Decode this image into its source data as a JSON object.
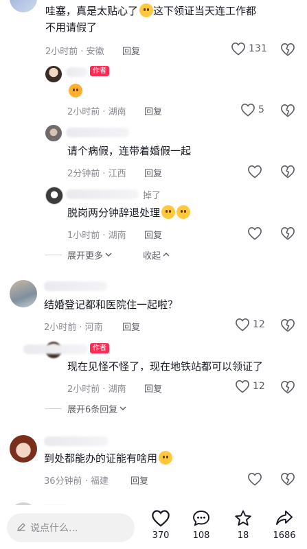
{
  "comments": [
    {
      "text": "哇塞，真是太贴心了",
      "text2": "这下领证当天连工作都",
      "text3": "不用请假了",
      "meta": "2小时前 · 安徽",
      "reply": "回复",
      "likes": "131"
    },
    {
      "author_tag": "作者",
      "meta": "2小时前 · 湖南",
      "reply": "回复",
      "likes": "5"
    },
    {
      "text": "请个病假，连带着婚假一起",
      "meta": "2分钟前 · 江西",
      "reply": "回复"
    },
    {
      "name_suffix": "掉了",
      "text": "脱岗两分钟辞退处理",
      "meta": "1小时前 · 湖南",
      "reply": "回复"
    },
    {
      "text": "结婚登记都和医院住一起啦？",
      "meta": "2小时前 · 河南",
      "reply": "回复",
      "likes": "12"
    },
    {
      "author_tag": "作者",
      "text": "现在见怪不怪了，现在地铁站都可以领证了",
      "meta": "2小时前 · 湖南",
      "reply": "回复",
      "likes": "12"
    },
    {
      "text": "到处都能办的证能有啥用",
      "meta": "36分钟前 · 福建",
      "reply": "回复"
    }
  ],
  "expand_more": "展开更多",
  "collapse": "收起",
  "expand_six": "展开6条回复",
  "bottom": {
    "placeholder": "说点什么...",
    "likes": "370",
    "comments": "108",
    "favorites": "18",
    "shares": "1686"
  }
}
